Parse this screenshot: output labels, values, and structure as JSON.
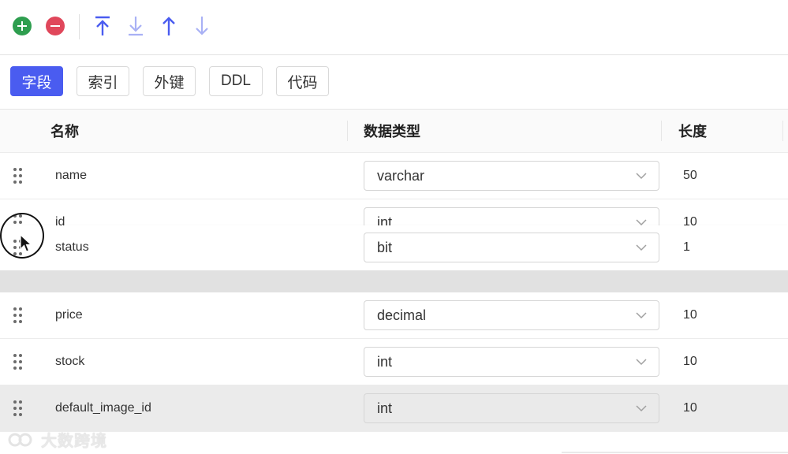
{
  "toolbar": {
    "add_icon": "plus-circle-icon",
    "remove_icon": "minus-circle-icon",
    "move_top_icon": "arrow-up-to-line-icon",
    "move_bottom_icon": "arrow-down-to-line-icon",
    "move_up_icon": "arrow-up-icon",
    "move_down_icon": "arrow-down-icon",
    "colors": {
      "add": "#2e9e4f",
      "remove": "#e0475b",
      "arrow_active": "#4a5cf0",
      "arrow_muted": "#a9b1f5"
    }
  },
  "tabs": [
    {
      "label": "字段",
      "active": true
    },
    {
      "label": "索引",
      "active": false
    },
    {
      "label": "外键",
      "active": false
    },
    {
      "label": "DDL",
      "active": false
    },
    {
      "label": "代码",
      "active": false
    }
  ],
  "columns": {
    "name": "名称",
    "type": "数据类型",
    "length": "长度"
  },
  "rows": [
    {
      "name": "name",
      "type": "varchar",
      "length": "50"
    },
    {
      "name": "id",
      "type": "int",
      "length": "10"
    },
    {
      "name": "price",
      "type": "decimal",
      "length": "10"
    },
    {
      "name": "stock",
      "type": "int",
      "length": "10"
    },
    {
      "name": "default_image_id",
      "type": "int",
      "length": "10"
    }
  ],
  "dragging_row": {
    "name": "status",
    "type": "bit",
    "length": "1"
  },
  "watermark": "大数跨境",
  "accent_color": "#4a5cf0"
}
